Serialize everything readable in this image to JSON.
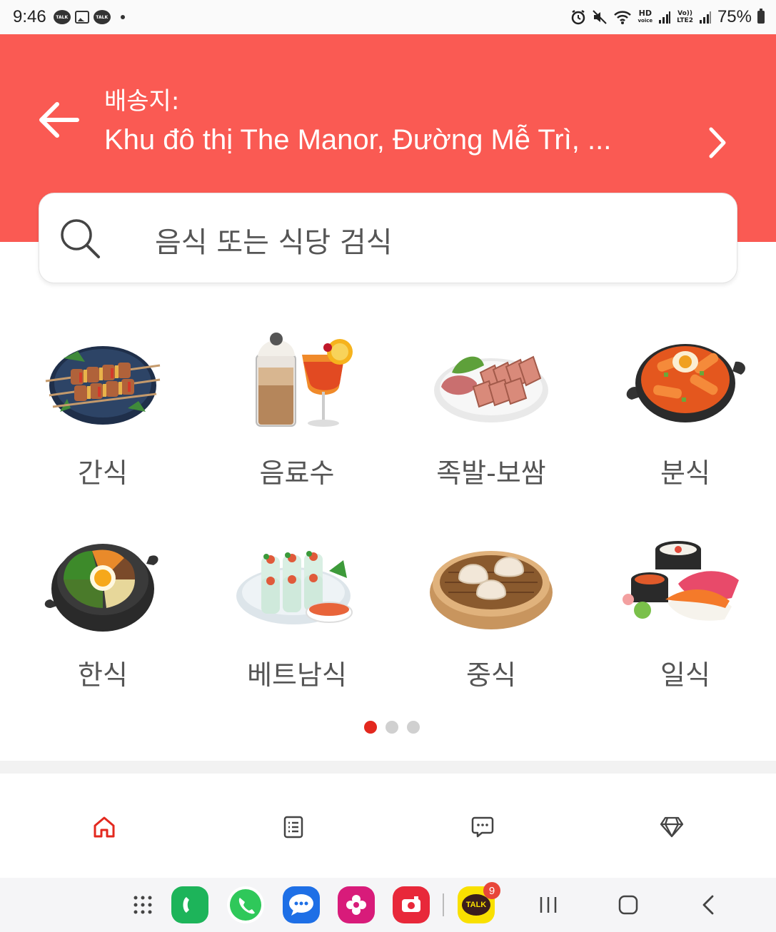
{
  "status_bar": {
    "time": "9:46",
    "battery": "75%",
    "hd_voice": "HD",
    "hd_sub": "voice",
    "lte_top": "Vo))",
    "lte_bottom": "LTE2"
  },
  "header": {
    "delivery_label": "배송지:",
    "address": "Khu đô thị The Manor, Đường Mễ Trì, ...",
    "bg_color": "#fa5a53"
  },
  "search": {
    "placeholder": "음식 또는 식당 검식"
  },
  "categories": [
    {
      "label": "간식",
      "icon": "skewers-icon"
    },
    {
      "label": "음료수",
      "icon": "drinks-icon"
    },
    {
      "label": "족발-보쌈",
      "icon": "sliced-pork-icon"
    },
    {
      "label": "분식",
      "icon": "tteokbokki-icon"
    },
    {
      "label": "한식",
      "icon": "bibimbap-icon"
    },
    {
      "label": "베트남식",
      "icon": "spring-rolls-icon"
    },
    {
      "label": "중식",
      "icon": "dumplings-icon"
    },
    {
      "label": "일식",
      "icon": "sushi-icon"
    }
  ],
  "pager": {
    "pages": 3,
    "active": 1,
    "active_color": "#e3281e"
  },
  "bottom_nav": [
    {
      "name": "home",
      "icon": "home-icon",
      "active": true
    },
    {
      "name": "orders",
      "icon": "list-icon",
      "active": false
    },
    {
      "name": "messages",
      "icon": "chat-icon",
      "active": false
    },
    {
      "name": "rewards",
      "icon": "diamond-icon",
      "active": false
    }
  ],
  "dock": {
    "kakaotalk_badge": "9",
    "kakaotalk_label": "TALK"
  }
}
